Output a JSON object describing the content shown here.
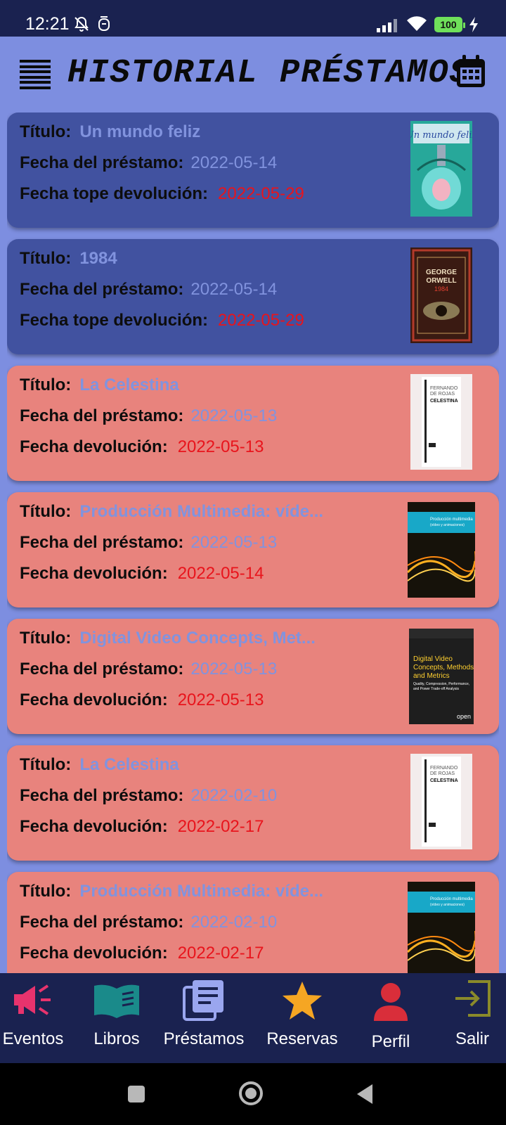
{
  "status_bar": {
    "time": "12:21",
    "battery": "100",
    "icons": [
      "notifications-off-icon",
      "alarm-icon",
      "signal-icon",
      "wifi-icon",
      "battery-icon",
      "charging-icon"
    ]
  },
  "header": {
    "title": "HISTORIAL PRÉSTAMOS",
    "menu_icon": "menu-icon",
    "calendar_icon": "calendar-icon"
  },
  "labels": {
    "title": "Título:",
    "loan_date": "Fecha del préstamo:",
    "due_date": "Fecha tope devolución:",
    "return_date": "Fecha devolución:"
  },
  "loans": [
    {
      "title": "Un mundo feliz",
      "loan_date": "2022-05-14",
      "due": "2022-05-29",
      "status": "active",
      "cover": "Un mundo feliz"
    },
    {
      "title": "1984",
      "loan_date": "2022-05-14",
      "due": "2022-05-29",
      "status": "active",
      "cover_author": "GEORGE ORWELL",
      "cover_title": "1984"
    },
    {
      "title": "La Celestina",
      "loan_date": "2022-05-13",
      "due": "2022-05-13",
      "status": "returned",
      "cover_author": "FERNANDO DE ROJAS",
      "cover_title": "CELESTINA"
    },
    {
      "title": "Producción Multimedia: víde...",
      "loan_date": "2022-05-13",
      "due": "2022-05-14",
      "status": "returned",
      "cover_title": "Producción multimedia (vídeo y animaciones)"
    },
    {
      "title": "Digital Video Concepts, Met...",
      "loan_date": "2022-05-13",
      "due": "2022-05-13",
      "status": "returned",
      "cover_title": "Digital Video Concepts, Methods, and Metrics",
      "cover_subtitle": "Quality, Compression, Performance, and Power Trade-off Analysis",
      "cover_brand": "open"
    },
    {
      "title": "La Celestina",
      "loan_date": "2022-02-10",
      "due": "2022-02-17",
      "status": "returned",
      "cover_author": "FERNANDO DE ROJAS",
      "cover_title": "CELESTINA"
    },
    {
      "title": "Producción Multimedia: víde...",
      "loan_date": "2022-02-10",
      "due": "2022-02-17",
      "status": "returned",
      "cover_title": "Producción multimedia (vídeo y animaciones)"
    }
  ],
  "nav": [
    {
      "label": "Eventos",
      "icon": "megaphone-icon",
      "color": "#e8336d"
    },
    {
      "label": "Libros",
      "icon": "book-icon",
      "color": "#1a8a8a"
    },
    {
      "label": "Préstamos",
      "icon": "documents-icon",
      "color": "#9aa6ef"
    },
    {
      "label": "Reservas",
      "icon": "star-icon",
      "color": "#f5a623"
    },
    {
      "label": "Perfil",
      "icon": "person-icon",
      "color": "#d92e3a"
    },
    {
      "label": "Salir",
      "icon": "exit-icon",
      "color": "#8a8a2a"
    }
  ],
  "colors": {
    "status_bar": "#1a2250",
    "page_bg": "#7d8ee0",
    "card_active": "#4152a0",
    "card_returned": "#e8837d",
    "value_blue": "#8193de",
    "value_red": "#e8141c"
  }
}
